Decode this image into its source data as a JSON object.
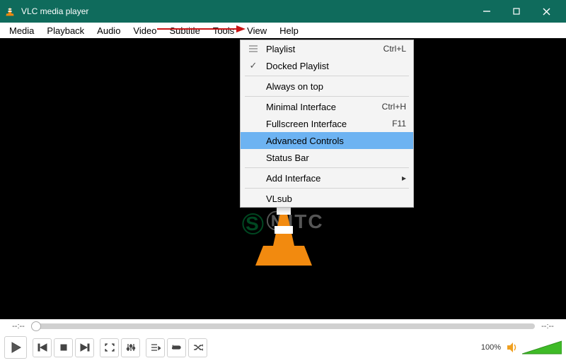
{
  "titlebar": {
    "app_title": "VLC media player"
  },
  "menubar": {
    "items": [
      "Media",
      "Playback",
      "Audio",
      "Video",
      "Subtitle",
      "Tools",
      "View",
      "Help"
    ]
  },
  "dropdown": {
    "playlist": {
      "label": "Playlist",
      "shortcut": "Ctrl+L"
    },
    "docked": {
      "label": "Docked Playlist"
    },
    "always_on_top": {
      "label": "Always on top"
    },
    "minimal": {
      "label": "Minimal Interface",
      "shortcut": "Ctrl+H"
    },
    "fullscreen": {
      "label": "Fullscreen Interface",
      "shortcut": "F11"
    },
    "advanced": {
      "label": "Advanced Controls"
    },
    "status_bar": {
      "label": "Status Bar"
    },
    "add_interface": {
      "label": "Add Interface"
    },
    "vlsub": {
      "label": "VLsub"
    }
  },
  "watermark_text": "SⓃITC",
  "seek": {
    "left_time": "--:--",
    "right_time": "--:--"
  },
  "volume": {
    "percent_label": "100%"
  }
}
